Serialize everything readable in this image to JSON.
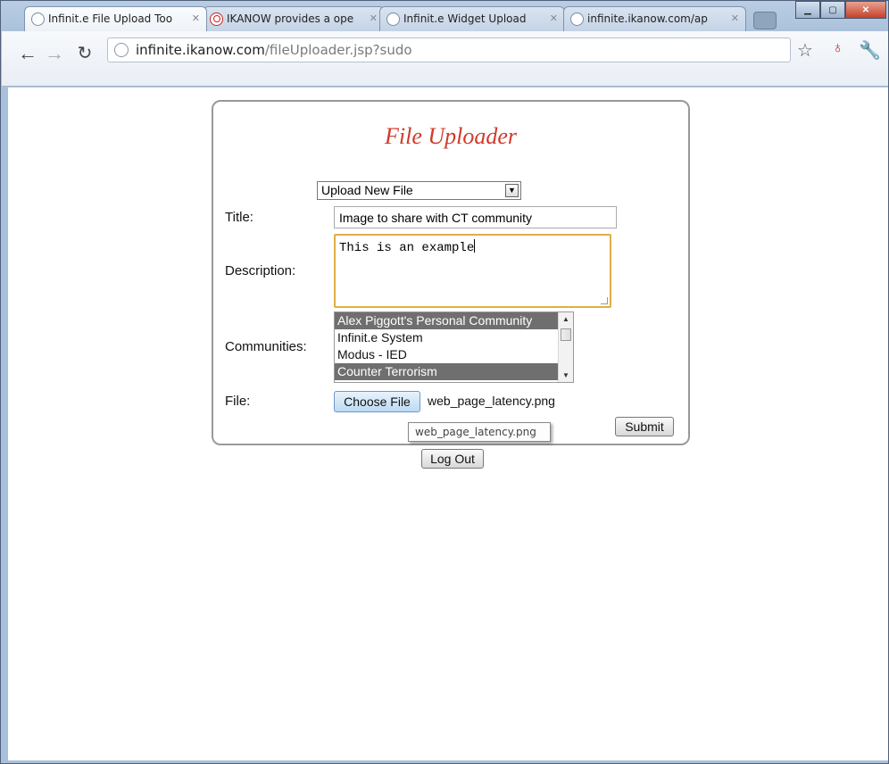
{
  "browser": {
    "tabs": [
      {
        "label": "Infinit.e File Upload Too",
        "icon": "globe-icon",
        "active": true
      },
      {
        "label": "IKANOW provides a ope",
        "icon": "ikanow-logo-icon",
        "active": false
      },
      {
        "label": "Infinit.e Widget Upload",
        "icon": "globe-icon",
        "active": false
      },
      {
        "label": "infinite.ikanow.com/ap",
        "icon": "globe-icon",
        "active": false
      }
    ],
    "url_host": "infinite.ikanow.com",
    "url_path": "/fileUploader.jsp?sudo"
  },
  "form": {
    "heading": "File Uploader",
    "mode_value": "Upload New File",
    "title_label": "Title:",
    "title_value": "Image to share with CT community",
    "description_label": "Description:",
    "description_value": "This is an example",
    "communities_label": "Communities:",
    "communities": [
      {
        "name": "Alex Piggott's Personal Community",
        "selected": true
      },
      {
        "name": "Infinit.e System",
        "selected": false
      },
      {
        "name": "Modus - IED",
        "selected": false
      },
      {
        "name": "Counter Terrorism",
        "selected": true
      }
    ],
    "file_label": "File:",
    "choose_file_label": "Choose File",
    "file_name": "web_page_latency.png",
    "submit_label": "Submit",
    "tooltip_text": "web_page_latency.png",
    "logout_label": "Log Out"
  },
  "colors": {
    "heading": "#d13a2b",
    "selected_item_bg": "#6f6f6f",
    "textarea_focus_border": "#e0ae46"
  }
}
